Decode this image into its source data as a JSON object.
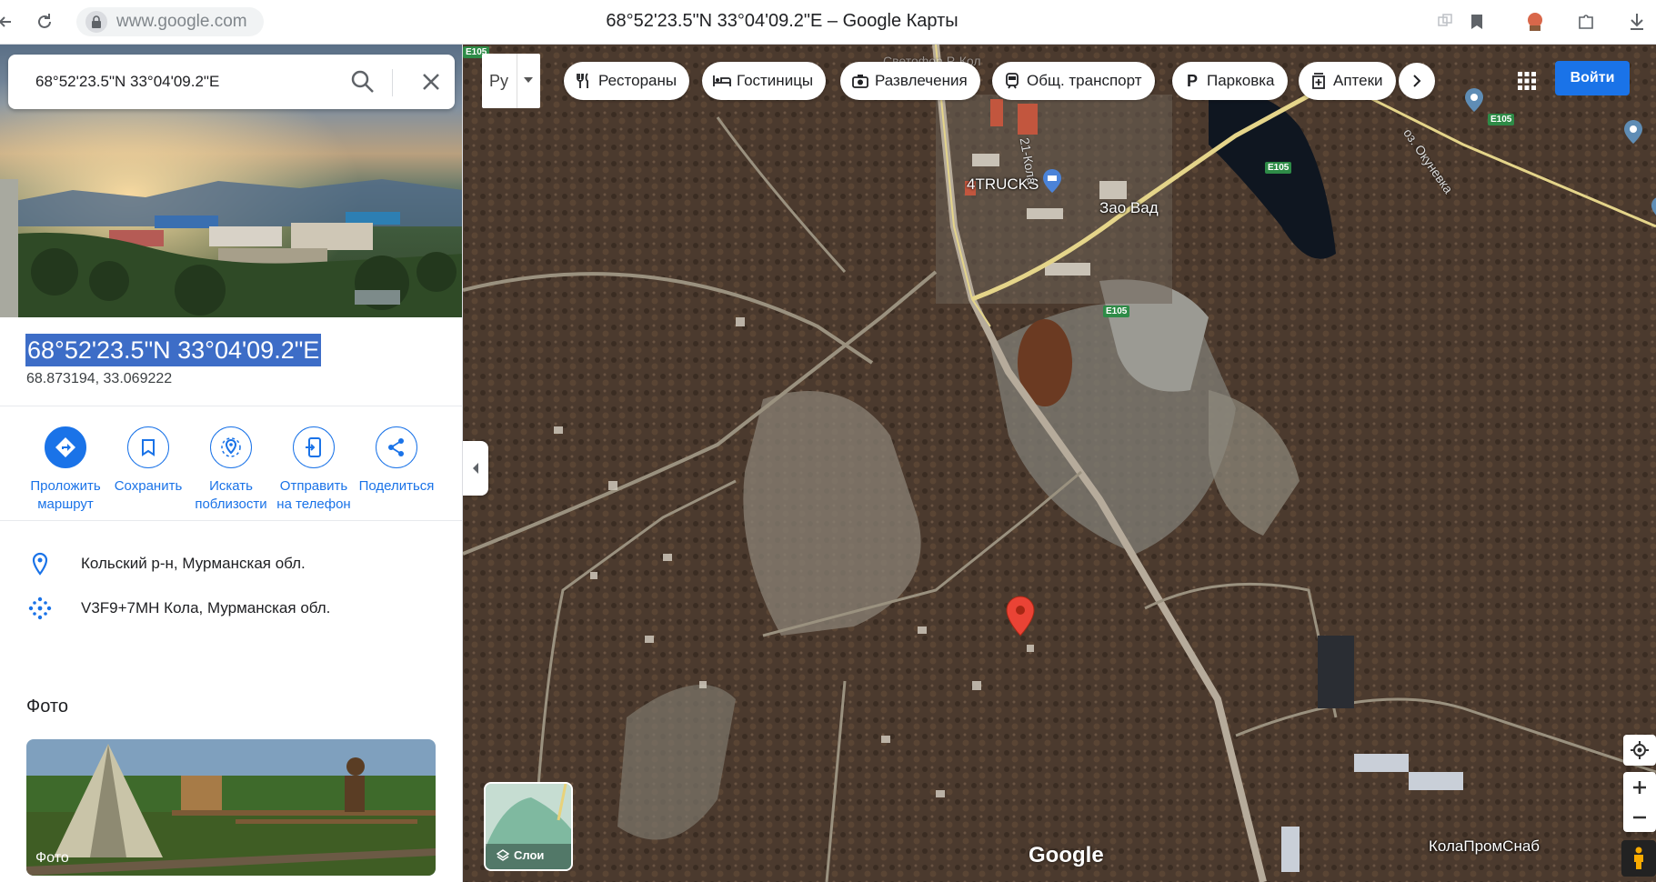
{
  "browser": {
    "url": "www.google.com",
    "window_title": "68°52'23.5\"N 33°04'09.2\"E – Google Карты"
  },
  "search": {
    "value": "68°52'23.5\"N 33°04'09.2\"E"
  },
  "place": {
    "title": "68°52'23.5\"N 33°04'09.2\"E",
    "decimal": "68.873194, 33.069222"
  },
  "actions": [
    {
      "line1": "Проложить",
      "line2": "маршрут",
      "icon": "directions-icon"
    },
    {
      "line1": "Сохранить",
      "line2": "",
      "icon": "bookmark-icon"
    },
    {
      "line1": "Искать",
      "line2": "поблизости",
      "icon": "nearby-icon"
    },
    {
      "line1": "Отправить",
      "line2": "на телефон",
      "icon": "send-to-phone-icon"
    },
    {
      "line1": "Поделиться",
      "line2": "",
      "icon": "share-icon"
    }
  ],
  "info": {
    "address": "Кольский р-н, Мурманская обл.",
    "pluscode": "V3F9+7MH Кола, Мурманская обл."
  },
  "photos": {
    "heading": "Фото",
    "card_label": "Фото"
  },
  "map": {
    "lang": "Ру",
    "chips": [
      {
        "label": "Рестораны",
        "icon": "restaurant-icon"
      },
      {
        "label": "Гостиницы",
        "icon": "hotel-icon"
      },
      {
        "label": "Развлечения",
        "icon": "camera-icon"
      },
      {
        "label": "Общ. транспорт",
        "icon": "transit-icon"
      },
      {
        "label": "Парковка",
        "icon": "parking-icon"
      },
      {
        "label": "Аптеки",
        "icon": "pharmacy-icon"
      }
    ],
    "signin": "Войти",
    "places": {
      "trucks": "4TRUCKS",
      "zao": "Зао Вад",
      "kolaprom": "КолаПромСнаб",
      "lake": "оз. Окуневка",
      "road_kola": "21-Кола",
      "top_faded": "Светофор Р-Кол"
    },
    "shields": [
      "E105",
      "E105",
      "E105",
      "E105"
    ],
    "layers": "Слои",
    "logo": "Google",
    "colors": {
      "marker": "#ea4335",
      "accent": "#1a73e8",
      "shield": "#2e8b47"
    }
  }
}
